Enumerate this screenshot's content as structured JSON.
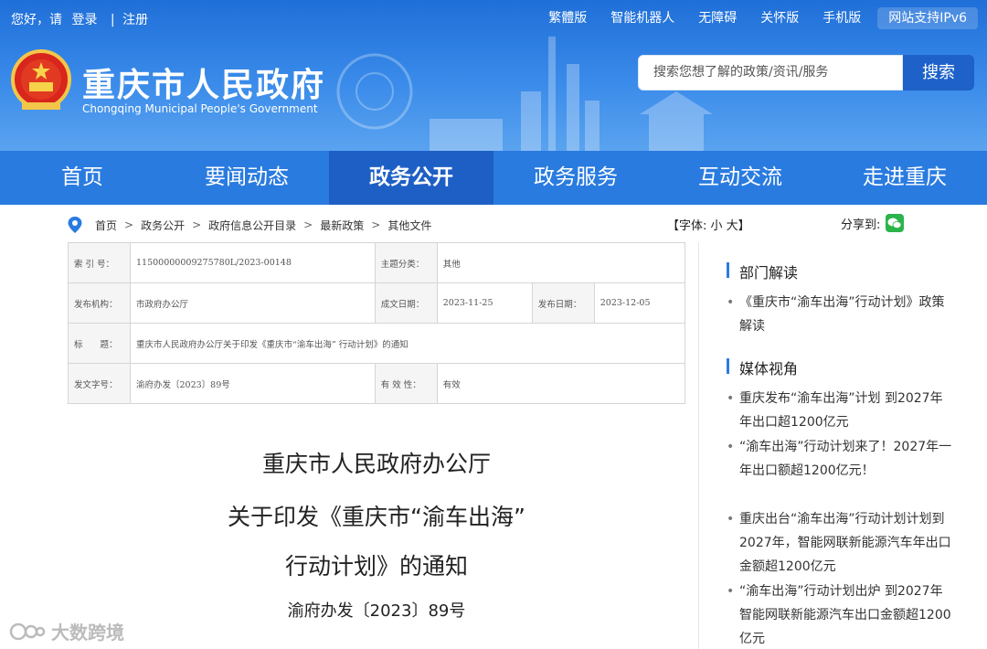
{
  "topbar": {
    "greeting": "您好，请",
    "login": "登录",
    "divider": "|",
    "register": "注册",
    "links": [
      "繁體版",
      "智能机器人",
      "无障碍",
      "关怀版",
      "手机版"
    ],
    "ipv6": "网站支持IPv6"
  },
  "site": {
    "title": "重庆市人民政府",
    "subtitle": "Chongqing Municipal People's Government",
    "emblem_icon": "national-emblem-icon"
  },
  "search": {
    "placeholder": "搜索您想了解的政策/资讯/服务",
    "button": "搜索"
  },
  "nav": {
    "items": [
      "首页",
      "要闻动态",
      "政务公开",
      "政务服务",
      "互动交流",
      "走进重庆"
    ],
    "active": "政务公开"
  },
  "breadcrumb": [
    "首页",
    "政务公开",
    "政府信息公开目录",
    "最新政策",
    "其他文件"
  ],
  "breadcrumb_sep": ">",
  "font_control": "【字体: 小 大】",
  "share_label": "分享到:",
  "info": {
    "index_label": "索 引 号：",
    "index_value": "11500000009275780L/2023-00148",
    "topic_label": "主题分类：",
    "topic_value": "其他",
    "org_label": "发布机构：",
    "org_value": "市政府办公厅",
    "written_label": "成文日期：",
    "written_value": "2023-11-25",
    "published_label": "发布日期：",
    "published_value": "2023-12-05",
    "title_label": "标　　题：",
    "title_value": "重庆市人民政府办公厅关于印发《重庆市“渝车出海” 行动计划》的通知",
    "docno_label": "发文字号：",
    "docno_value": "渝府办发〔2023〕89号",
    "valid_label": "有 效 性：",
    "valid_value": "有效"
  },
  "doc": {
    "line1": "重庆市人民政府办公厅",
    "line2": "关于印发《重庆市“渝车出海”",
    "line3": "行动计划》的通知",
    "number": "渝府办发〔2023〕89号"
  },
  "sidebar": {
    "dept_title": "部门解读",
    "dept_items": [
      "《重庆市“渝车出海”行动计划》政策解读"
    ],
    "media_title": "媒体视角",
    "media_items": [
      "重庆发布“渝车出海”计划 到2027年年出口超1200亿元",
      "“渝车出海”行动计划来了！2027年一年出口额超1200亿元！",
      "重庆出台“渝车出海”行动计划计划到2027年，智能网联新能源汽车年出口金额超1200亿元",
      "“渝车出海”行动计划出炉 到2027年智能网联新能源汽车出口金额超1200亿元"
    ]
  },
  "watermark": "大数跨境",
  "colors": {
    "header": "#2a7be0",
    "nav_active": "#1d5fc5",
    "search_button": "#1e62c9"
  }
}
